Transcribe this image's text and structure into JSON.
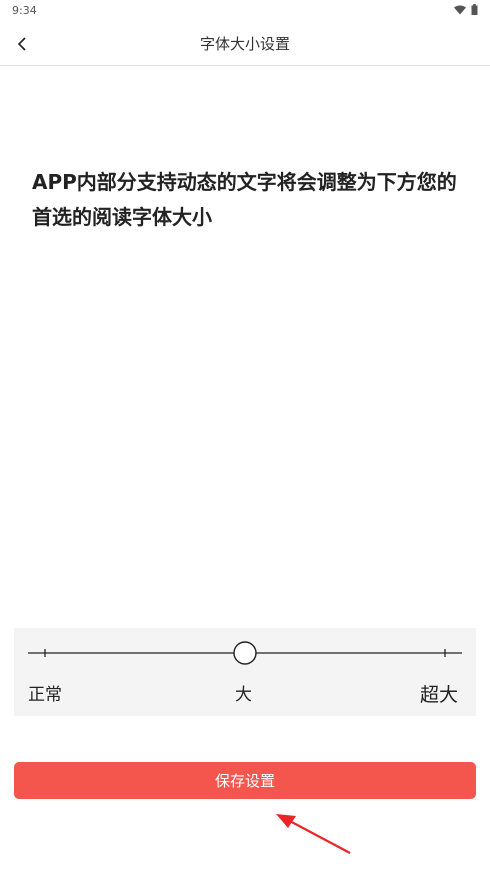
{
  "status_bar": {
    "time": "9:34",
    "icons": [
      "wifi-icon",
      "battery-icon"
    ]
  },
  "app_bar": {
    "back_icon": "chevron-left-icon",
    "title": "字体大小设置"
  },
  "preview": {
    "text": "APP内部分支持动态的文字将会调整为下方您的首选的阅读字体大小"
  },
  "font_size_slider": {
    "labels": [
      "正常",
      "大",
      "超大"
    ],
    "step_count": 3,
    "selected_index": 1,
    "selected_label": "大"
  },
  "save_button": {
    "label": "保存设置"
  },
  "annotation": {
    "arrow_color": "#e8262a"
  },
  "colors": {
    "accent": "#f4564e",
    "panel_bg": "#f4f4f4"
  }
}
